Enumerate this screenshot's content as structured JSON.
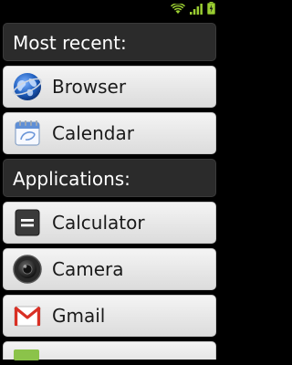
{
  "status_bar": {
    "icons": [
      "wifi-icon",
      "signal-icon",
      "battery-icon"
    ],
    "color": "#9acd32"
  },
  "sections": [
    {
      "header": "Most recent:",
      "items": [
        {
          "label": "Browser",
          "icon": "browser-globe-icon"
        },
        {
          "label": "Calendar",
          "icon": "calendar-icon"
        }
      ]
    },
    {
      "header": "Applications:",
      "items": [
        {
          "label": "Calculator",
          "icon": "calculator-icon"
        },
        {
          "label": "Camera",
          "icon": "camera-icon"
        },
        {
          "label": "Gmail",
          "icon": "gmail-icon"
        }
      ]
    }
  ],
  "partial_item": {
    "icon": "app-icon-green"
  },
  "colors": {
    "header_bg": "#2b2b2b",
    "item_bg": "#e8e8e8",
    "status_accent": "#9acd32"
  }
}
